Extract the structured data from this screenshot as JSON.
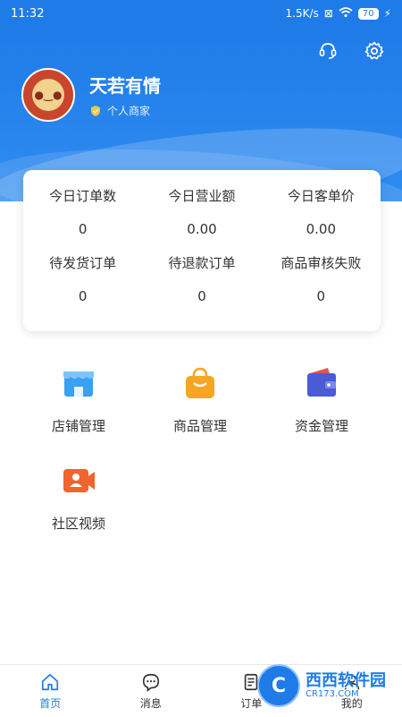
{
  "status_bar": {
    "time": "11:32",
    "speed": "1.5K/s",
    "battery": "70"
  },
  "profile": {
    "name": "天若有情",
    "type": "个人商家"
  },
  "stats": [
    {
      "label": "今日订单数",
      "value": "0"
    },
    {
      "label": "今日营业额",
      "value": "0.00"
    },
    {
      "label": "今日客单价",
      "value": "0.00"
    },
    {
      "label": "待发货订单",
      "value": "0"
    },
    {
      "label": "待退款订单",
      "value": "0"
    },
    {
      "label": "商品审核失败",
      "value": "0"
    }
  ],
  "menu": [
    {
      "label": "店铺管理",
      "icon": "store-icon",
      "color": "#3AA0F0"
    },
    {
      "label": "商品管理",
      "icon": "shopping-bag-icon",
      "color": "#F6A623"
    },
    {
      "label": "资金管理",
      "icon": "wallet-icon",
      "color": "#4A5BD6"
    },
    {
      "label": "社区视频",
      "icon": "video-camera-icon",
      "color": "#F0642E"
    }
  ],
  "tabs": [
    {
      "label": "首页",
      "icon": "home-icon",
      "active": true
    },
    {
      "label": "消息",
      "icon": "message-icon",
      "active": false
    },
    {
      "label": "订单",
      "icon": "order-icon",
      "active": false
    },
    {
      "label": "我的",
      "icon": "profile-icon",
      "active": false
    }
  ],
  "watermark": {
    "title": "西西软件园",
    "sub": "CR173.COM"
  },
  "colors": {
    "primary": "#1E7BE8",
    "text": "#333333"
  }
}
